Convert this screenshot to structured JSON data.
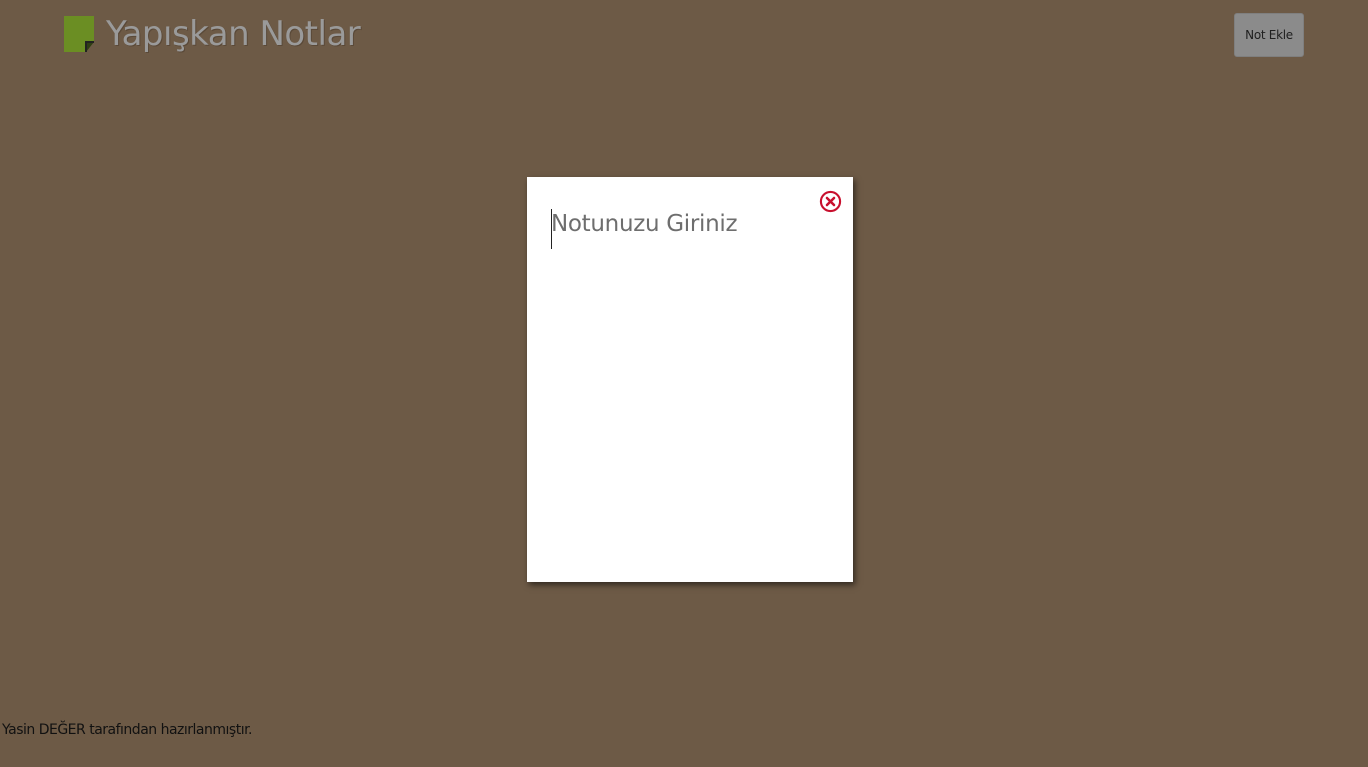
{
  "header": {
    "title": "Yapışkan Notlar",
    "logo_icon": "sticky-note-icon",
    "logo_color": "#6b8e23",
    "add_note_label": "Not Ekle"
  },
  "note": {
    "placeholder": "Notunuzu Giriniz",
    "value": "",
    "close_icon": "close-circle-icon",
    "close_color": "#c8102e"
  },
  "footer": {
    "credit": "Yasin DEĞER tarafından hazırlanmıştır."
  },
  "colors": {
    "background": "#6d5a46",
    "note_background": "#ffffff",
    "button_background": "#8b8b8b"
  }
}
